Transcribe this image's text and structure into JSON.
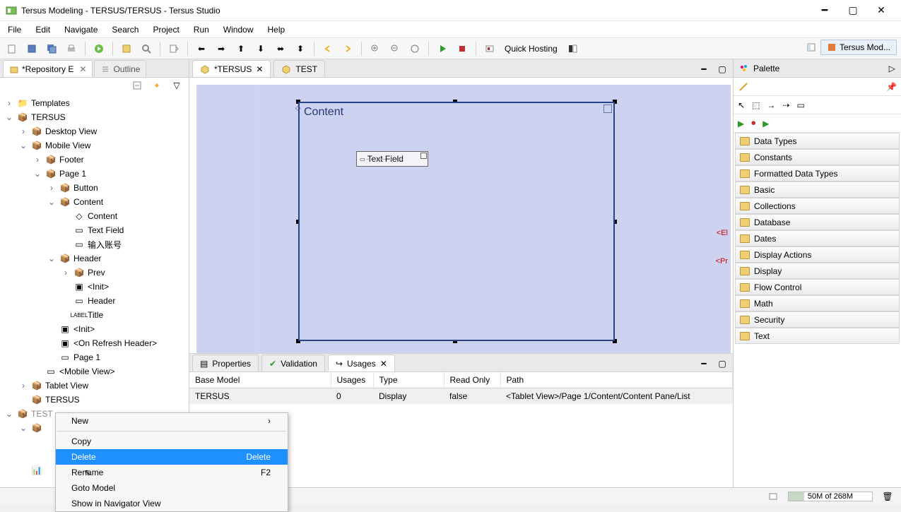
{
  "title": "Tersus Modeling - TERSUS/TERSUS - Tersus Studio",
  "menu": {
    "file": "File",
    "edit": "Edit",
    "navigate": "Navigate",
    "search": "Search",
    "project": "Project",
    "run": "Run",
    "window": "Window",
    "help": "Help"
  },
  "toolbar": {
    "quickHosting": "Quick Hosting"
  },
  "perspective": {
    "label": "Tersus Mod..."
  },
  "leftTabs": {
    "repo": "*Repository E",
    "outline": "Outline"
  },
  "tree": {
    "templates": "Templates",
    "tersus": "TERSUS",
    "desktopView": "Desktop View",
    "mobileView": "Mobile View",
    "footer": "Footer",
    "page1": "Page 1",
    "button": "Button",
    "content": "Content",
    "contentInner": "Content",
    "textField": "Text Field",
    "inputAccount": "输入账号",
    "header": "Header",
    "prev": "Prev",
    "init": "<Init>",
    "headerInner": "Header",
    "title": "Title",
    "init2": "<Init>",
    "onRefreshHeader": "<On Refresh Header>",
    "page1b": "Page 1",
    "mobileViewBracket": "<Mobile View>",
    "tabletView": "Tablet View",
    "tersus2": "TERSUS",
    "test": "TEST",
    "cut": "[…]"
  },
  "editorTabs": {
    "tersus": "*TERSUS",
    "test": "TEST"
  },
  "canvas": {
    "contentLabel": "Content",
    "textField": "Text Field",
    "elLabel": "<El",
    "prLabel": "<Pr"
  },
  "bottomTabs": {
    "properties": "Properties",
    "validation": "Validation",
    "usages": "Usages"
  },
  "usages": {
    "cols": {
      "base": "Base Model",
      "usages": "Usages",
      "type": "Type",
      "readOnly": "Read Only",
      "path": "Path"
    },
    "row": {
      "base": "TERSUS",
      "usages": "0",
      "type": "Display",
      "readOnly": "false",
      "path": "<Tablet View>/Page 1/Content/Content Pane/List"
    }
  },
  "palette": {
    "title": "Palette",
    "cats": [
      "Data Types",
      "Constants",
      "Formatted Data Types",
      "Basic",
      "Collections",
      "Database",
      "Dates",
      "Display Actions",
      "Display",
      "Flow Control",
      "Math",
      "Security",
      "Text"
    ]
  },
  "ctx": {
    "new": "New",
    "copy": "Copy",
    "delete": "Delete",
    "deleteKey": "Delete",
    "rename": "Rename",
    "renameKey": "F2",
    "gotoModel": "Goto Model",
    "showNav": "Show in Navigator View"
  },
  "status": {
    "mem": "50M of 268M"
  }
}
